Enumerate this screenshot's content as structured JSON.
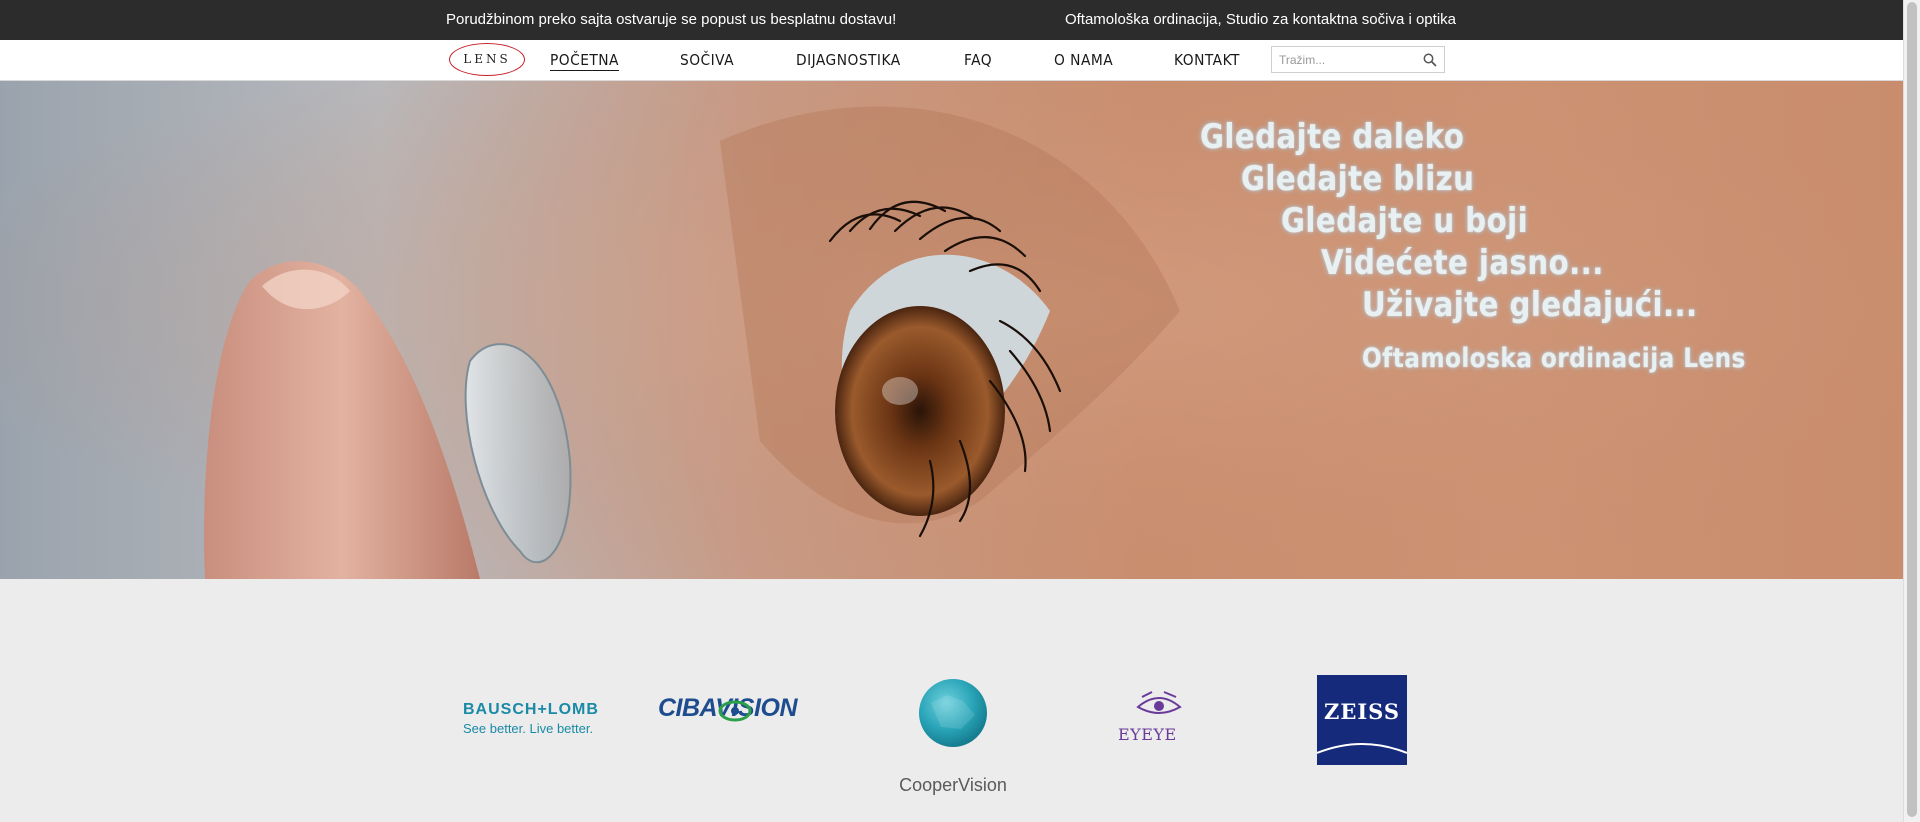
{
  "topbar": {
    "promo_text": "Porudžbinom preko sajta ostvaruje se popust us besplatnu dostavu!",
    "tagline_text": "Oftamološka ordinacija, Studio za kontaktna sočiva i optika"
  },
  "nav": {
    "logo_text": "LENS",
    "items": [
      {
        "label": "POČETNA"
      },
      {
        "label": "SOČIVA"
      },
      {
        "label": "DIJAGNOSTIKA"
      },
      {
        "label": "FAQ"
      },
      {
        "label": "O NAMA"
      },
      {
        "label": "KONTAKT"
      }
    ],
    "active_item": "POČETNA",
    "search": {
      "placeholder": "Tražim...",
      "value": "",
      "icon": "search-icon"
    }
  },
  "hero": {
    "lines": [
      "Gledajte daleko",
      "Gledajte blizu",
      "Gledajte u boji",
      "Videćete jasno...",
      "Uživajte gledajući...",
      "Oftamoloska ordinacija Lens"
    ],
    "text_color": "#e9f0f2"
  },
  "brands": {
    "bausch_lomb": {
      "name": "BAUSCH+LOMB",
      "tagline": "See better. Live better."
    },
    "ciba_vision": {
      "name": "CIBAVISION"
    },
    "cooper_vision": {
      "name": "CooperVision",
      "mark": "™"
    },
    "eyeye": {
      "name": "EYEYE"
    },
    "zeiss": {
      "name": "ZEISS"
    }
  },
  "colors": {
    "topbar_bg": "#2c2c2c",
    "logo_ring": "#c8202a",
    "brands_bg": "#ececec"
  }
}
